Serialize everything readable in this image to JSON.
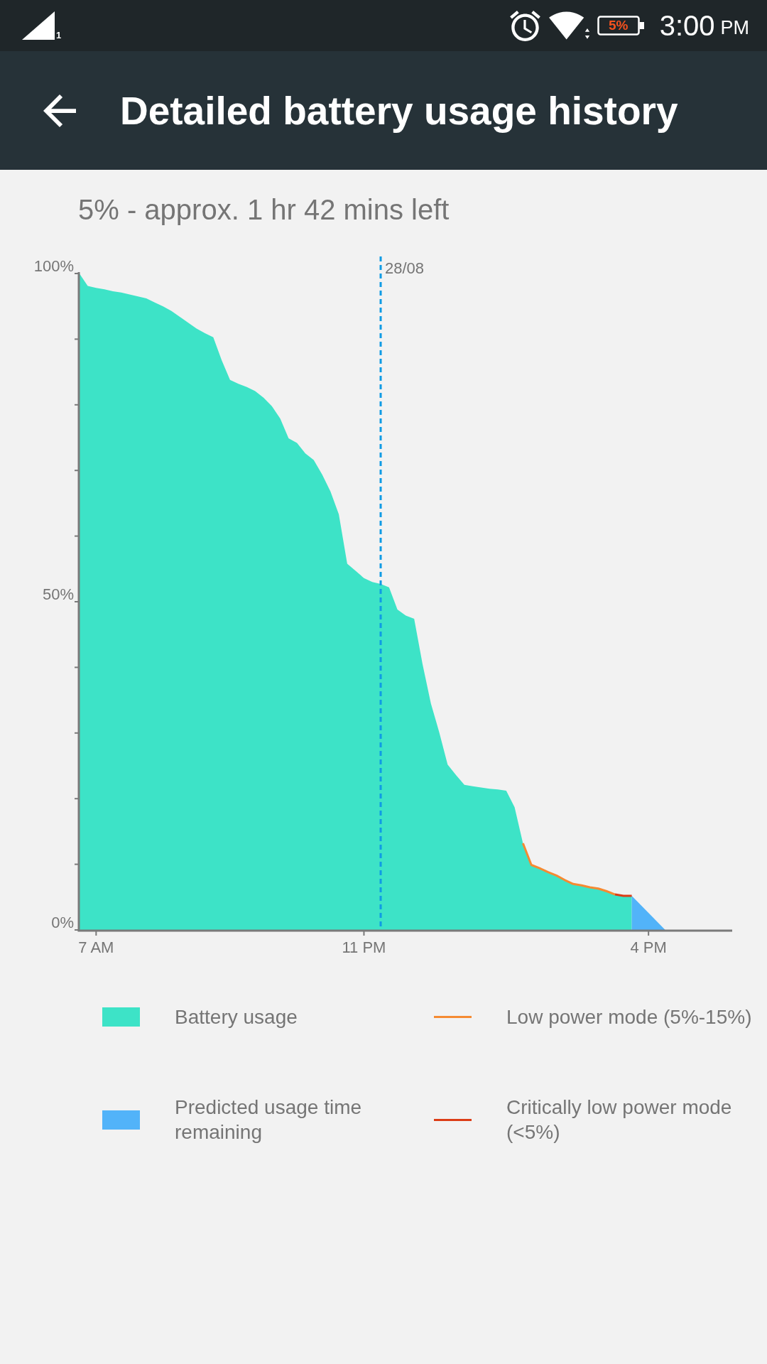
{
  "status_bar": {
    "sim_slot": "1",
    "battery_text": "5%",
    "time": "3:00",
    "time_period": "PM"
  },
  "toolbar": {
    "title": "Detailed battery usage history"
  },
  "summary": "5% - approx. 1 hr 42 mins left",
  "chart": {
    "chart_data": {
      "type": "area",
      "categories": [
        null,
        null,
        "7 AM",
        null,
        null,
        null,
        null,
        null,
        null,
        null,
        null,
        null,
        null,
        null,
        null,
        null,
        null,
        null,
        null,
        null,
        null,
        null,
        null,
        null,
        null,
        null,
        null,
        null,
        null,
        null,
        null,
        null,
        null,
        null,
        "11 PM",
        null,
        null,
        null,
        null,
        null,
        null,
        null,
        null,
        null,
        null,
        null,
        null,
        null,
        null,
        null,
        null,
        null,
        null,
        null,
        null,
        null,
        null,
        null,
        null,
        null,
        null,
        null,
        null,
        null,
        null,
        null,
        null,
        null,
        "4 PM",
        null,
        null,
        null,
        null,
        null,
        null,
        null,
        null,
        null,
        null
      ],
      "series": [
        {
          "name": "Battery usage",
          "type": "area",
          "color": "#3de3c7",
          "values": [
            100,
            98.1,
            97.8,
            97.6,
            97.3,
            97.1,
            96.8,
            96.5,
            96.2,
            95.6,
            95.0,
            94.3,
            93.4,
            92.5,
            91.6,
            90.9,
            90.3,
            86.8,
            83.8,
            83.2,
            82.7,
            82.1,
            81.1,
            79.8,
            77.9,
            74.9,
            74.2,
            72.6,
            71.6,
            69.4,
            66.8,
            63.3,
            55.8,
            54.7,
            53.6,
            53.0,
            52.7,
            52.2,
            48.8,
            47.9,
            47.4,
            40.5,
            34.5,
            30.1,
            25.2,
            23.6,
            22.1,
            21.9,
            21.7,
            21.5,
            21.4,
            21.2,
            18.7,
            13.2,
            9.9,
            9.4,
            8.8,
            8.3,
            7.6,
            7.0,
            6.8,
            6.5,
            6.3,
            5.9,
            5.4,
            5.2,
            5.2,
            null,
            null,
            null,
            null,
            null,
            null,
            null,
            null,
            null,
            null,
            null,
            null
          ]
        },
        {
          "name": "Low power mode (5%-15%)",
          "type": "line",
          "color": "#f58a32",
          "values": [
            null,
            null,
            null,
            null,
            null,
            null,
            null,
            null,
            null,
            null,
            null,
            null,
            null,
            null,
            null,
            null,
            null,
            null,
            null,
            null,
            null,
            null,
            null,
            null,
            null,
            null,
            null,
            null,
            null,
            null,
            null,
            null,
            null,
            null,
            null,
            null,
            null,
            null,
            null,
            null,
            null,
            null,
            null,
            null,
            null,
            null,
            null,
            null,
            null,
            null,
            null,
            null,
            null,
            13.2,
            9.9,
            9.4,
            8.8,
            8.3,
            7.6,
            7.0,
            6.8,
            6.5,
            6.3,
            5.9,
            5.4,
            null,
            null,
            null,
            null,
            null,
            null,
            null,
            null,
            null,
            null,
            null,
            null,
            null,
            null
          ]
        },
        {
          "name": "Predicted usage time remaining",
          "type": "area",
          "color": "#52b3f9",
          "values": [
            null,
            null,
            null,
            null,
            null,
            null,
            null,
            null,
            null,
            null,
            null,
            null,
            null,
            null,
            null,
            null,
            null,
            null,
            null,
            null,
            null,
            null,
            null,
            null,
            null,
            null,
            null,
            null,
            null,
            null,
            null,
            null,
            null,
            null,
            null,
            null,
            null,
            null,
            null,
            null,
            null,
            null,
            null,
            null,
            null,
            null,
            null,
            null,
            null,
            null,
            null,
            null,
            null,
            null,
            null,
            null,
            null,
            null,
            null,
            null,
            null,
            null,
            null,
            null,
            null,
            null,
            5.2,
            3.9,
            2.6,
            1.3,
            0,
            null,
            null,
            null,
            null,
            null,
            null,
            null,
            null
          ]
        },
        {
          "name": "Critically low power mode (<5%)",
          "type": "line",
          "color": "#dc3d16",
          "values": [
            null,
            null,
            null,
            null,
            null,
            null,
            null,
            null,
            null,
            null,
            null,
            null,
            null,
            null,
            null,
            null,
            null,
            null,
            null,
            null,
            null,
            null,
            null,
            null,
            null,
            null,
            null,
            null,
            null,
            null,
            null,
            null,
            null,
            null,
            null,
            null,
            null,
            null,
            null,
            null,
            null,
            null,
            null,
            null,
            null,
            null,
            null,
            null,
            null,
            null,
            null,
            null,
            null,
            null,
            null,
            null,
            null,
            null,
            null,
            null,
            null,
            null,
            null,
            null,
            5.4,
            5.2,
            5.2,
            null,
            null,
            null,
            null,
            null,
            null,
            null,
            null,
            null,
            null,
            null,
            null
          ]
        }
      ],
      "ylim": [
        0,
        100
      ],
      "yticks": [
        {
          "value": 0,
          "label": "0%"
        },
        {
          "value": 50,
          "label": "50%"
        },
        {
          "value": 100,
          "label": "100%"
        }
      ],
      "annotations": [
        "28/08"
      ]
    }
  }
}
